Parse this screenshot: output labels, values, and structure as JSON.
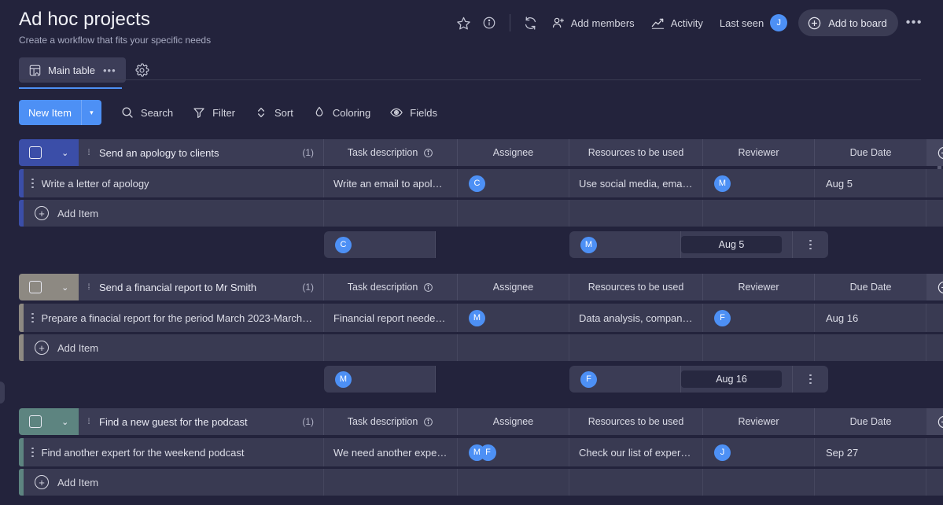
{
  "header": {
    "title": "Ad hoc projects",
    "subtitle": "Create a workflow that fits your specific needs",
    "actions": {
      "star_icon": "star-icon",
      "info_icon": "info-icon",
      "refresh_icon": "refresh-icon",
      "add_members_label": "Add members",
      "activity_label": "Activity",
      "last_seen_label": "Last seen",
      "last_seen_avatar": "J",
      "add_to_board_label": "Add to board",
      "more_label": "•••"
    }
  },
  "view_tabs": {
    "main_tab_label": "Main table",
    "main_tab_dots": "•••",
    "gear_icon": "gear-icon"
  },
  "toolbar": {
    "new_item_label": "New Item",
    "new_item_caret": "▾",
    "search_label": "Search",
    "filter_label": "Filter",
    "sort_label": "Sort",
    "coloring_label": "Coloring",
    "fields_label": "Fields"
  },
  "columns": {
    "name_placeholder": "",
    "description": "Task description",
    "assignee": "Assignee",
    "resources": "Resources to be used",
    "reviewer": "Reviewer",
    "due_date": "Due Date",
    "add_column_icon": "plus-circle-icon"
  },
  "common": {
    "add_item_label": "Add Item",
    "count_label": "(1)"
  },
  "colors": {
    "accent_blue": "#4d90f5",
    "group1": "#3b4ea8",
    "group2": "#8d8982",
    "group3": "#5d8480",
    "avatar": "#4d90f5",
    "background": "#23233c",
    "cell": "#393a52",
    "header_cell": "#3b3c55"
  },
  "groups": [
    {
      "title": "Send an apology to clients",
      "count": "(1)",
      "color": "#3b4ea8",
      "rows": [
        {
          "name": "Write a letter of apology",
          "description": "Write an email to apologi…",
          "assignees": [
            "C"
          ],
          "resources": "Use social media, email …",
          "reviewers": [
            "M"
          ],
          "due_date": "Aug 5"
        }
      ],
      "summary": {
        "assignees": [
          "C"
        ],
        "reviewers": [
          "M"
        ],
        "due_date": "Aug 5"
      }
    },
    {
      "title": "Send a financial report to Mr Smith",
      "count": "(1)",
      "color": "#8d8982",
      "rows": [
        {
          "name": "Prepare a finacial report for the period March 2023-March…",
          "description": "Financial report needed f…",
          "assignees": [
            "M"
          ],
          "resources": "Data analysis, company …",
          "reviewers": [
            "F"
          ],
          "due_date": "Aug 16"
        }
      ],
      "summary": {
        "assignees": [
          "M"
        ],
        "reviewers": [
          "F"
        ],
        "due_date": "Aug 16"
      }
    },
    {
      "title": "Find a new guest for the podcast",
      "count": "(1)",
      "color": "#5d8480",
      "rows": [
        {
          "name": "Find another expert for the weekend podcast",
          "description": "We need another expert t…",
          "assignees": [
            "M",
            "F"
          ],
          "resources": "Check our list of experts …",
          "reviewers": [
            "J"
          ],
          "due_date": "Sep 27"
        }
      ],
      "summary": null
    }
  ]
}
